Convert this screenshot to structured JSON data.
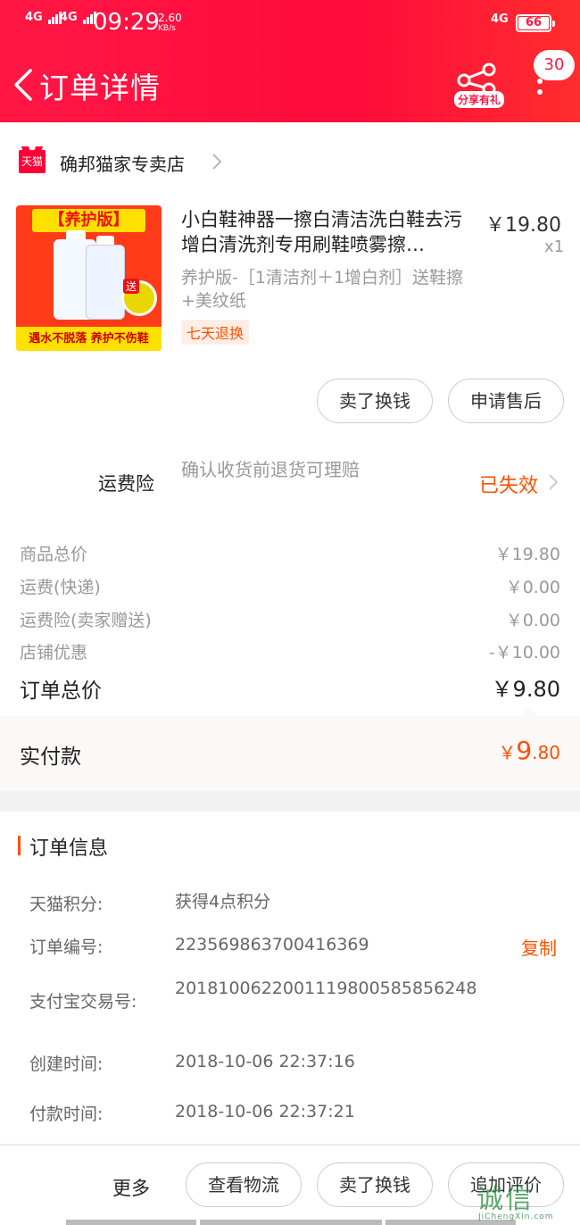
{
  "status_bar": {
    "signal1": "4G",
    "signal2": "4G",
    "time": "09:29",
    "speed_value": "2.60",
    "speed_unit": "KB/s",
    "network_right": "4G",
    "battery": "66"
  },
  "header": {
    "title": "订单详情",
    "share_label": "分享有礼",
    "notification_count": "30"
  },
  "shop": {
    "logo_text": "天猫",
    "name": "确邦猫家专卖店"
  },
  "product": {
    "image_top_text": "【养护版】",
    "image_bottom_text": "遇水不脱落 养护不伤鞋",
    "image_tag": "送",
    "title": "小白鞋神器一擦白清洁洗白鞋去污增白清洗剂专用刷鞋喷雾擦…",
    "price": "￥19.80",
    "quantity": "x1",
    "sku": "养护版-［1清洁剂＋1增白剂］送鞋擦+美纹纸",
    "tag": "七天退换"
  },
  "product_actions": {
    "sell_label": "卖了换钱",
    "after_sale_label": "申请售后"
  },
  "insurance": {
    "label": "运费险",
    "description": "确认收货前退货可理赔",
    "status": "已失效"
  },
  "price_rows": [
    {
      "label": "商品总价",
      "value": "￥19.80"
    },
    {
      "label": "运费(快递)",
      "value": "￥0.00"
    },
    {
      "label": "运费险(卖家赠送)",
      "value": "￥0.00"
    },
    {
      "label": "店铺优惠",
      "value": "-￥10.00"
    }
  ],
  "total": {
    "label": "订单总价",
    "value": "￥9.80"
  },
  "paid": {
    "label": "实付款",
    "currency": "￥",
    "integer": "9",
    "decimal": ".80"
  },
  "order_info": {
    "title": "订单信息",
    "rows": [
      {
        "label": "天猫积分:",
        "value": "获得4点积分"
      },
      {
        "label": "订单编号:",
        "value": "223569863700416369"
      },
      {
        "label": "支付宝交易号:",
        "value": "2018100622001119800585856248"
      },
      {
        "label": "创建时间:",
        "value": "2018-10-06 22:37:16"
      },
      {
        "label": "付款时间:",
        "value": "2018-10-06 22:37:21"
      }
    ],
    "copy_label": "复制"
  },
  "bottom_bar": {
    "more_label": "更多",
    "logistics_label": "查看物流",
    "sell_label": "卖了换钱",
    "review_label": "追加评价"
  },
  "watermark": {
    "main": "诚信",
    "sub": "JiChengXin.com"
  }
}
